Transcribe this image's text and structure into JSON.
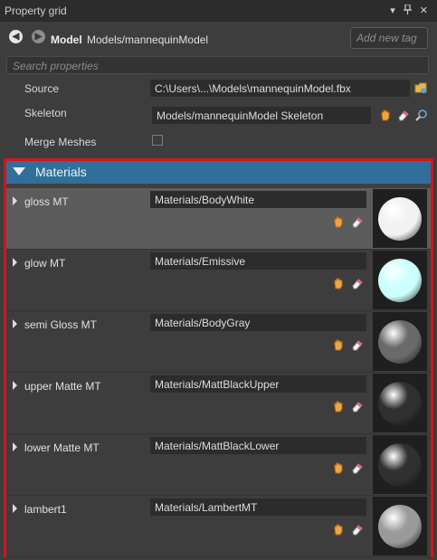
{
  "window": {
    "title": "Property grid"
  },
  "titlebar_controls": [
    "▾",
    "✕",
    "🖈",
    "✕"
  ],
  "toolbar": {
    "model_label": "Model",
    "model_path": "Models/mannequinModel",
    "tag_placeholder": "Add new tag"
  },
  "search": {
    "placeholder": "Search properties"
  },
  "properties": {
    "source": {
      "label": "Source",
      "value": "C:\\Users\\...\\Models\\mannequinModel.fbx"
    },
    "skeleton": {
      "label": "Skeleton",
      "value": "Models/mannequinModel Skeleton"
    },
    "merge_meshes": {
      "label": "Merge Meshes",
      "checked": false
    }
  },
  "materials": {
    "title": "Materials",
    "items": [
      {
        "name": "gloss MT",
        "value": "Materials/BodyWhite",
        "selected": true,
        "preview_color": "#f2f2f2"
      },
      {
        "name": "glow MT",
        "value": "Materials/Emissive",
        "selected": false,
        "preview_color": "#ccffff"
      },
      {
        "name": "semi Gloss MT",
        "value": "Materials/BodyGray",
        "selected": false,
        "preview_color": "#6a6a6a"
      },
      {
        "name": "upper Matte MT",
        "value": "Materials/MattBlackUpper",
        "selected": false,
        "preview_color": "#303030"
      },
      {
        "name": "lower Matte MT",
        "value": "Materials/MattBlackLower",
        "selected": false,
        "preview_color": "#303030"
      },
      {
        "name": "lambert1",
        "value": "Materials/LambertMT",
        "selected": false,
        "preview_color": "#9a9a9a"
      }
    ]
  },
  "colors": {
    "accent": "#2f6f9a",
    "highlight_border": "#d0161d"
  }
}
